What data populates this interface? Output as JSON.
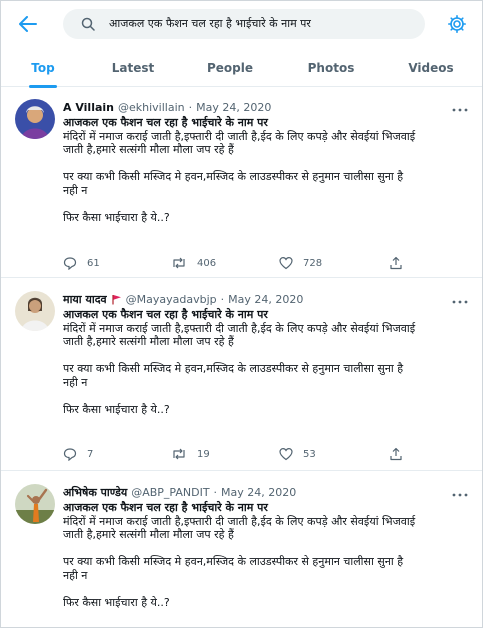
{
  "search": {
    "query": "आजकल एक फैशन चल रहा है भाईचारे के नाम पर"
  },
  "tabs": [
    {
      "label": "Top",
      "active": true
    },
    {
      "label": "Latest",
      "active": false
    },
    {
      "label": "People",
      "active": false
    },
    {
      "label": "Photos",
      "active": false
    },
    {
      "label": "Videos",
      "active": false
    }
  ],
  "tweets": [
    {
      "name": "A Villain",
      "handle": "@ekhivillain",
      "sep": "·",
      "date": "May 24, 2020",
      "has_flag": false,
      "lines": [
        "आजकल एक फैशन चल रहा है भाईचारे के नाम पर",
        "मंदिरों में नमाज कराई जाती है,इफ्तारी दी जाती है,ईद के लिए कपड़े और सेवईयां भिजवाई",
        "जाती है,हमारे सत्संगी मौला मौला जप रहे हैं",
        "",
        "पर क्या कभी किसी मस्जिद मे हवन,मस्जिद के  लाउडस्पीकर से हनुमान चालीसा सुना है",
        "नही न",
        "",
        "फिर कैसा भाईचारा है ये..?"
      ],
      "replies": "61",
      "retweets": "406",
      "likes": "728"
    },
    {
      "name": "माया यादव",
      "handle": "@Mayayadavbjp",
      "sep": "·",
      "date": "May 24, 2020",
      "has_flag": true,
      "lines": [
        "आजकल एक फैशन चल रहा है भाईचारे के नाम पर",
        "मंदिरों में नमाज कराई जाती है,इफ्तारी दी जाती है,ईद के लिए कपड़े और सेवईयां भिजवाई",
        "जाती है,हमारे सत्संगी मौला मौला जप रहे हैं",
        "",
        "पर क्या कभी किसी मस्जिद मे हवन,मस्जिद के  लाउडस्पीकर से हनुमान चालीसा सुना है",
        "नही न",
        "",
        "फिर कैसा भाईचारा है ये..?"
      ],
      "replies": "7",
      "retweets": "19",
      "likes": "53"
    },
    {
      "name": "अभिषेक पाण्डेय",
      "handle": "@ABP_PANDIT",
      "sep": "·",
      "date": "May 24, 2020",
      "has_flag": false,
      "lines": [
        "आजकल एक फैशन चल रहा है भाईचारे के नाम पर",
        "मंदिरों में नमाज कराई जाती है,इफ्तारी दी जाती है,ईद के लिए कपड़े और सेवईयां भिजवाई",
        "जाती है,हमारे सत्संगी मौला मौला जप रहे हैं",
        "",
        "पर क्या कभी किसी मस्जिद मे हवन,मस्जिद के  लाउडस्पीकर से हनुमान चालीसा सुना है",
        "नही न",
        "",
        "फिर कैसा भाईचारा है ये..?"
      ]
    }
  ],
  "colors": {
    "accent": "#1d9bf0",
    "secondary_text": "#536471",
    "search_bg": "#eff3f4",
    "flag": "#e0245e"
  }
}
